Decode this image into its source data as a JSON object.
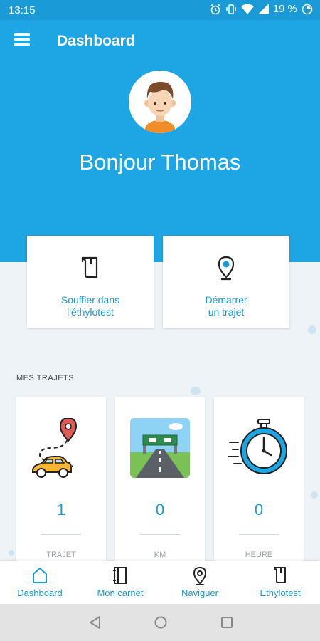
{
  "status_bar": {
    "time": "13:15",
    "battery": "19 %",
    "icons": [
      "alarm-icon",
      "vibrate-icon",
      "wifi-icon",
      "signal-icon",
      "battery-icon"
    ]
  },
  "header": {
    "title": "Dashboard",
    "greeting": "Bonjour Thomas",
    "color": "#1ea5e4"
  },
  "actions": [
    {
      "line1": "Souffler dans",
      "line2": "l'éthylotest",
      "icon": "breathalyzer-icon"
    },
    {
      "line1": "Démarrer",
      "line2": "un trajet",
      "icon": "location-pin-icon"
    }
  ],
  "trips": {
    "section_title": "MES TRAJETS",
    "stats": [
      {
        "value": "1",
        "label": "TRAJET",
        "illustration": "car-route-illustration"
      },
      {
        "value": "0",
        "label": "KM",
        "illustration": "highway-illustration"
      },
      {
        "value": "0",
        "label": "HEURE",
        "illustration": "stopwatch-illustration"
      }
    ]
  },
  "bottom_nav": [
    {
      "label": "Dashboard",
      "icon": "home-icon"
    },
    {
      "label": "Mon carnet",
      "icon": "notebook-icon"
    },
    {
      "label": "Naviguer",
      "icon": "location-pin-icon"
    },
    {
      "label": "Ethylotest",
      "icon": "breathalyzer-icon"
    }
  ],
  "accent_color": "#1a9ad6"
}
